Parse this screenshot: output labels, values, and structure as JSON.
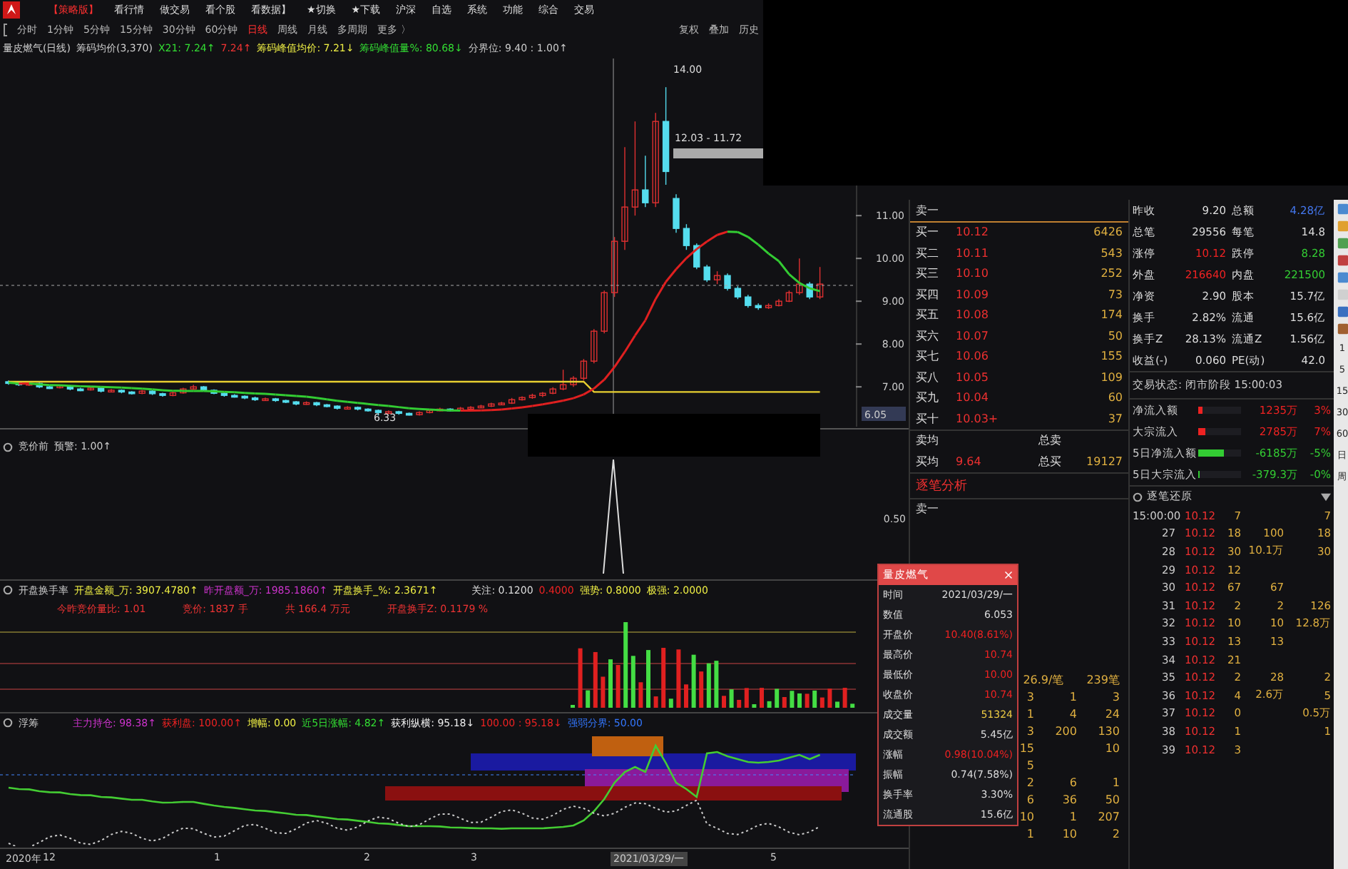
{
  "menu": {
    "items": [
      {
        "label": "【策略版】",
        "selected": true
      },
      {
        "label": "看行情",
        "selected": false
      },
      {
        "label": "做交易",
        "selected": false
      },
      {
        "label": "看个股",
        "selected": false
      },
      {
        "label": "看数据】",
        "selected": false
      },
      {
        "label": "★切换",
        "selected": false
      },
      {
        "label": "★下载",
        "selected": false
      },
      {
        "label": "沪深",
        "selected": false
      },
      {
        "label": "自选",
        "selected": false
      },
      {
        "label": "系统",
        "selected": false
      },
      {
        "label": "功能",
        "selected": false
      },
      {
        "label": "综合",
        "selected": false
      },
      {
        "label": "交易",
        "selected": false
      }
    ]
  },
  "periods": {
    "items": [
      {
        "label": "分时",
        "selected": false
      },
      {
        "label": "1分钟",
        "selected": false
      },
      {
        "label": "5分钟",
        "selected": false
      },
      {
        "label": "15分钟",
        "selected": false
      },
      {
        "label": "30分钟",
        "selected": false
      },
      {
        "label": "60分钟",
        "selected": false
      },
      {
        "label": "日线",
        "selected": true
      },
      {
        "label": "周线",
        "selected": false
      },
      {
        "label": "月线",
        "selected": false
      },
      {
        "label": "多周期",
        "selected": false
      },
      {
        "label": "更多 〉",
        "selected": false
      }
    ],
    "actions": [
      "复权",
      "叠加",
      "历史"
    ]
  },
  "main_chart": {
    "legend": [
      {
        "text": "量皮燃气(日线)",
        "color": "#cccccc"
      },
      {
        "text": "筹码均价(3,370)",
        "color": "#cccccc"
      },
      {
        "text": "X21: 7.24↑",
        "color": "#33dd33"
      },
      {
        "text": "7.24↑",
        "color": "#ee3333"
      },
      {
        "text": "筹码峰值均价: 7.21↓",
        "color": "#eeee44"
      },
      {
        "text": "筹码峰值量%: 80.68↓",
        "color": "#33dd33"
      },
      {
        "text": "分界位: 9.40 : 1.00↑",
        "color": "#cccccc"
      }
    ],
    "high_label": "14.00",
    "range_label": "12.03 - 11.72",
    "low_label": "6.33",
    "current_price": "6.05",
    "chart_data": {
      "type": "candlestick",
      "ohlc": [
        [
          7.12,
          7.15,
          7.05,
          7.1
        ],
        [
          7.1,
          7.13,
          7.02,
          7.05
        ],
        [
          7.05,
          7.11,
          7.02,
          7.08
        ],
        [
          7.08,
          7.1,
          6.97,
          7.0
        ],
        [
          7.0,
          7.03,
          6.95,
          6.98
        ],
        [
          6.98,
          7.05,
          6.96,
          7.02
        ],
        [
          7.02,
          7.04,
          6.92,
          6.95
        ],
        [
          6.95,
          6.98,
          6.9,
          6.93
        ],
        [
          6.93,
          7.0,
          6.91,
          6.97
        ],
        [
          6.97,
          6.99,
          6.87,
          6.9
        ],
        [
          6.9,
          6.95,
          6.88,
          6.92
        ],
        [
          6.92,
          6.94,
          6.85,
          6.88
        ],
        [
          6.88,
          6.9,
          6.82,
          6.85
        ],
        [
          6.85,
          6.93,
          6.83,
          6.9
        ],
        [
          6.9,
          6.92,
          6.81,
          6.84
        ],
        [
          6.84,
          6.86,
          6.77,
          6.8
        ],
        [
          6.8,
          6.89,
          6.78,
          6.86
        ],
        [
          6.86,
          6.98,
          6.84,
          6.95
        ],
        [
          6.95,
          7.05,
          6.93,
          7.0
        ],
        [
          7.0,
          7.02,
          6.9,
          6.92
        ],
        [
          6.92,
          6.94,
          6.83,
          6.85
        ],
        [
          6.85,
          6.87,
          6.77,
          6.8
        ],
        [
          6.8,
          6.83,
          6.75,
          6.78
        ],
        [
          6.78,
          6.8,
          6.71,
          6.74
        ],
        [
          6.74,
          6.77,
          6.67,
          6.7
        ],
        [
          6.7,
          6.75,
          6.68,
          6.72
        ],
        [
          6.72,
          6.74,
          6.65,
          6.68
        ],
        [
          6.68,
          6.7,
          6.62,
          6.65
        ],
        [
          6.65,
          6.67,
          6.57,
          6.6
        ],
        [
          6.6,
          6.66,
          6.58,
          6.63
        ],
        [
          6.63,
          6.65,
          6.55,
          6.58
        ],
        [
          6.58,
          6.6,
          6.52,
          6.55
        ],
        [
          6.55,
          6.57,
          6.47,
          6.5
        ],
        [
          6.5,
          6.55,
          6.48,
          6.52
        ],
        [
          6.52,
          6.54,
          6.45,
          6.48
        ],
        [
          6.48,
          6.5,
          6.42,
          6.45
        ],
        [
          6.45,
          6.47,
          6.33,
          6.4
        ],
        [
          6.4,
          6.45,
          6.38,
          6.42
        ],
        [
          6.42,
          6.44,
          6.35,
          6.38
        ],
        [
          6.38,
          6.4,
          6.33,
          6.35
        ],
        [
          6.35,
          6.43,
          6.33,
          6.4
        ],
        [
          6.4,
          6.48,
          6.38,
          6.45
        ],
        [
          6.45,
          6.51,
          6.43,
          6.48
        ],
        [
          6.48,
          6.5,
          6.43,
          6.46
        ],
        [
          6.46,
          6.53,
          6.44,
          6.5
        ],
        [
          6.5,
          6.55,
          6.48,
          6.52
        ],
        [
          6.52,
          6.58,
          6.5,
          6.55
        ],
        [
          6.55,
          6.63,
          6.53,
          6.6
        ],
        [
          6.6,
          6.65,
          6.58,
          6.62
        ],
        [
          6.62,
          6.74,
          6.6,
          6.7
        ],
        [
          6.7,
          6.78,
          6.68,
          6.75
        ],
        [
          6.75,
          6.84,
          6.72,
          6.8
        ],
        [
          6.8,
          6.88,
          6.76,
          6.85
        ],
        [
          6.85,
          6.99,
          6.83,
          6.95
        ],
        [
          6.95,
          7.4,
          6.92,
          7.05
        ],
        [
          7.05,
          7.25,
          7.0,
          7.2
        ],
        [
          7.2,
          7.65,
          7.15,
          7.6
        ],
        [
          7.6,
          8.35,
          7.55,
          8.3
        ],
        [
          8.3,
          9.25,
          8.25,
          9.2
        ],
        [
          9.2,
          10.5,
          9.1,
          10.4
        ],
        [
          10.4,
          12.6,
          10.2,
          11.2
        ],
        [
          11.2,
          13.2,
          11.0,
          11.6
        ],
        [
          11.6,
          12.4,
          11.2,
          11.3
        ],
        [
          11.3,
          13.4,
          11.2,
          13.2
        ],
        [
          13.2,
          14.0,
          11.72,
          12.03
        ],
        [
          11.4,
          11.5,
          10.6,
          10.7
        ],
        [
          10.7,
          10.8,
          10.2,
          10.3
        ],
        [
          10.3,
          10.35,
          9.75,
          9.8
        ],
        [
          9.8,
          9.85,
          9.45,
          9.5
        ],
        [
          9.5,
          9.7,
          9.4,
          9.6
        ],
        [
          9.6,
          9.65,
          9.25,
          9.3
        ],
        [
          9.3,
          9.35,
          9.05,
          9.1
        ],
        [
          9.1,
          9.15,
          8.85,
          8.9
        ],
        [
          8.9,
          8.95,
          8.8,
          8.85
        ],
        [
          8.85,
          8.95,
          8.82,
          8.9
        ],
        [
          8.9,
          9.05,
          8.88,
          9.0
        ],
        [
          9.0,
          9.25,
          8.98,
          9.2
        ],
        [
          9.2,
          10.0,
          9.15,
          9.4
        ],
        [
          9.4,
          9.45,
          9.05,
          9.1
        ],
        [
          9.1,
          9.8,
          9.05,
          9.4
        ]
      ],
      "ylim": [
        6.07,
        14.67
      ],
      "yticks": [
        {
          "value": 11,
          "label": "11.00"
        },
        {
          "value": 10,
          "label": "10.00"
        },
        {
          "value": 9,
          "label": "9.00"
        },
        {
          "value": 8,
          "label": "8.00"
        },
        {
          "value": 7,
          "label": "7.00"
        }
      ]
    }
  },
  "panel_1": {
    "legend": [
      {
        "text": "竞价前",
        "color": "#cccccc"
      },
      {
        "text": "预警: 1.00↑",
        "color": "#cccccc"
      }
    ],
    "axis_label": "0.50"
  },
  "panel_2": {
    "legend": [
      {
        "text": "开盘换手率",
        "color": "#cccccc"
      },
      {
        "text": "开盘金额_万: 3907.4780↑",
        "color": "#eeee44"
      },
      {
        "text": "昨开盘额_万: 1985.1860↑",
        "color": "#cc33cc"
      },
      {
        "text": "开盘换手_%: 2.3671↑",
        "color": "#eeee44"
      },
      {
        "text": "关注: 0.1200",
        "color": "#dddddd"
      },
      {
        "text": "0.4000",
        "color": "#ee2222"
      },
      {
        "text": "强势: 0.8000",
        "color": "#eeee44"
      },
      {
        "text": "极强: 2.0000",
        "color": "#eeee44"
      }
    ],
    "info": [
      {
        "text": "今昨竞价量比: 1.01",
        "color": "#ee3333"
      },
      {
        "text": "竞价: 1837 手",
        "color": "#ee3333"
      },
      {
        "text": "共 166.4 万元",
        "color": "#ee3333"
      },
      {
        "text": "开盘换手Z: 0.1179 %",
        "color": "#ee3333"
      }
    ]
  },
  "panel_3": {
    "legend": [
      {
        "text": "浮筹",
        "color": "#cccccc"
      },
      {
        "text": "主力持仓: 98.38↑",
        "color": "#cc33cc"
      },
      {
        "text": "获利盘: 100.00↑",
        "color": "#ee2222"
      },
      {
        "text": "增幅: 0.00",
        "color": "#eeee44"
      },
      {
        "text": "近5日涨幅: 4.82↑",
        "color": "#33dd33"
      },
      {
        "text": "获利纵横: 95.18↓",
        "color": "#eeeeee"
      },
      {
        "text": "100.00 : 95.18↓",
        "color": "#ee2222"
      },
      {
        "text": "强弱分界: 50.00",
        "color": "#3377ff"
      }
    ]
  },
  "date_axis": [
    {
      "text": "2020年",
      "selected": false
    },
    {
      "text": "12",
      "selected": false
    },
    {
      "text": "1",
      "selected": false
    },
    {
      "text": "2",
      "selected": false
    },
    {
      "text": "3",
      "selected": false
    },
    {
      "text": "2021/03/29/一",
      "selected": true
    },
    {
      "text": "5",
      "selected": false
    }
  ],
  "order_book": {
    "asks": [
      "卖一"
    ],
    "bids": [
      {
        "label": "买一",
        "price": "10.12",
        "volume": "6426"
      },
      {
        "label": "买二",
        "price": "10.11",
        "volume": "543"
      },
      {
        "label": "买三",
        "price": "10.10",
        "volume": "252"
      },
      {
        "label": "买四",
        "price": "10.09",
        "volume": "73"
      },
      {
        "label": "买五",
        "price": "10.08",
        "volume": "174"
      },
      {
        "label": "买六",
        "price": "10.07",
        "volume": "50"
      },
      {
        "label": "买七",
        "price": "10.06",
        "volume": "155"
      },
      {
        "label": "买八",
        "price": "10.05",
        "volume": "109"
      },
      {
        "label": "买九",
        "price": "10.04",
        "volume": "60"
      },
      {
        "label": "买十",
        "price": "10.03+",
        "volume": "37"
      }
    ],
    "sell_avg": {
      "label": "卖均",
      "total_label": "总卖"
    },
    "buy_avg": {
      "label": "买均",
      "value": "9.64",
      "total_label": "总买",
      "total": "19127"
    },
    "analysis_title": "逐笔分析",
    "analysis_row": "卖一",
    "deal_summary": [
      "26.9/笔",
      "239笔"
    ],
    "deal_rows": [
      [
        "3",
        "1",
        "3"
      ],
      [
        "1",
        "4",
        "24"
      ],
      [
        "3",
        "200",
        "130"
      ],
      [
        "15",
        "",
        "10"
      ],
      [
        "5",
        "",
        ""
      ],
      [
        "2",
        "6",
        "1"
      ],
      [
        "6",
        "36",
        "50"
      ],
      [
        "10",
        "1",
        "207"
      ],
      [
        "1",
        "10",
        "2"
      ]
    ]
  },
  "quote": {
    "rows": [
      [
        {
          "label": "昨收",
          "value": "9.20",
          "color": "#dddddd"
        },
        {
          "label": "总额",
          "value": "4.28亿",
          "color": "#4477ee"
        }
      ],
      [
        {
          "label": "总笔",
          "value": "29556",
          "color": "#dddddd"
        },
        {
          "label": "每笔",
          "value": "14.8",
          "color": "#dddddd"
        }
      ],
      [
        {
          "label": "涨停",
          "value": "10.12",
          "color": "#ee2222"
        },
        {
          "label": "跌停",
          "value": "8.28",
          "color": "#33cc33"
        }
      ],
      [
        {
          "label": "外盘",
          "value": "216640",
          "color": "#ee2222"
        },
        {
          "label": "内盘",
          "value": "221500",
          "color": "#33cc33"
        }
      ],
      [
        {
          "label": "净资",
          "value": "2.90",
          "color": "#dddddd"
        },
        {
          "label": "股本",
          "value": "15.7亿",
          "color": "#dddddd"
        }
      ],
      [
        {
          "label": "换手",
          "value": "2.82%",
          "color": "#dddddd"
        },
        {
          "label": "流通",
          "value": "15.6亿",
          "color": "#dddddd"
        }
      ],
      [
        {
          "label": "换手Z",
          "value": "28.13%",
          "color": "#dddddd"
        },
        {
          "label": "流通Z",
          "value": "1.56亿",
          "color": "#dddddd"
        }
      ],
      [
        {
          "label": "收益(-)",
          "value": "0.060",
          "color": "#dddddd"
        },
        {
          "label": "PE(动)",
          "value": "42.0",
          "color": "#dddddd"
        }
      ]
    ],
    "status": "交易状态: 闭市阶段 15:00:03",
    "flows": [
      {
        "label": "净流入额",
        "amount": "1235万",
        "pct": "3%",
        "color": "#ee2222",
        "level": 0.1
      },
      {
        "label": "大宗流入",
        "amount": "2785万",
        "pct": "7%",
        "color": "#ee2222",
        "level": 0.15
      },
      {
        "label": "5日净流入额",
        "amount": "-6185万",
        "pct": "-5%",
        "color": "#33cc33",
        "level": 0.6
      },
      {
        "label": "5日大宗流入",
        "amount": "-379.3万",
        "pct": "-0%",
        "color": "#33cc33",
        "level": 0.03
      }
    ]
  },
  "ticks": {
    "title": "逐笔还原",
    "rows": [
      {
        "time": "15:00:00",
        "price": "10.12",
        "volume": "7",
        "col_4": "",
        "col_5": "7"
      },
      {
        "time": "27",
        "price": "10.12",
        "volume": "18",
        "col_4": "100",
        "col_5": "18"
      },
      {
        "time": "28",
        "price": "10.12",
        "volume": "30",
        "col_4": "10.1万",
        "col_5": "30"
      },
      {
        "time": "29",
        "price": "10.12",
        "volume": "12",
        "col_4": "",
        "col_5": ""
      },
      {
        "time": "30",
        "price": "10.12",
        "volume": "67",
        "col_4": "67",
        "col_5": ""
      },
      {
        "time": "31",
        "price": "10.12",
        "volume": "2",
        "col_4": "2",
        "col_5": "126"
      },
      {
        "time": "32",
        "price": "10.12",
        "volume": "10",
        "col_4": "10",
        "col_5": "12.8万"
      },
      {
        "time": "33",
        "price": "10.12",
        "volume": "13",
        "col_4": "13",
        "col_5": ""
      },
      {
        "time": "34",
        "price": "10.12",
        "volume": "21",
        "col_4": "",
        "col_5": ""
      },
      {
        "time": "35",
        "price": "10.12",
        "volume": "2",
        "col_4": "28",
        "col_5": "2"
      },
      {
        "time": "36",
        "price": "10.12",
        "volume": "4",
        "col_4": "2.6万",
        "col_5": "5"
      },
      {
        "time": "37",
        "price": "10.12",
        "volume": "0",
        "col_4": "",
        "col_5": "0.5万"
      },
      {
        "time": "38",
        "price": "10.12",
        "volume": "1",
        "col_4": "",
        "col_5": "1"
      },
      {
        "time": "39",
        "price": "10.12",
        "volume": "3",
        "col_4": "",
        "col_5": ""
      }
    ]
  },
  "toolbar": {
    "labels": [
      "1",
      "5",
      "15",
      "30",
      "60",
      "日",
      "周"
    ]
  },
  "popup": {
    "title": "量皮燃气",
    "rows": [
      {
        "label": "时间",
        "value": "2021/03/29/一",
        "color": "#dddddd"
      },
      {
        "label": "数值",
        "value": "6.053",
        "color": "#dddddd"
      },
      {
        "label": "开盘价",
        "value": "10.40(8.61%)",
        "color": "#ee2222"
      },
      {
        "label": "最高价",
        "value": "10.74",
        "color": "#ee2222"
      },
      {
        "label": "最低价",
        "value": "10.00",
        "color": "#ee2222"
      },
      {
        "label": "收盘价",
        "value": "10.74",
        "color": "#ee2222"
      },
      {
        "label": "成交量",
        "value": "51324",
        "color": "#eecc44"
      },
      {
        "label": "成交额",
        "value": "5.45亿",
        "color": "#dddddd"
      },
      {
        "label": "涨幅",
        "value": "0.98(10.04%)",
        "color": "#ee2222"
      },
      {
        "label": "振幅",
        "value": "0.74(7.58%)",
        "color": "#dddddd"
      },
      {
        "label": "换手率",
        "value": "3.30%",
        "color": "#dddddd"
      },
      {
        "label": "流通股",
        "value": "15.6亿",
        "color": "#dddddd"
      }
    ]
  }
}
